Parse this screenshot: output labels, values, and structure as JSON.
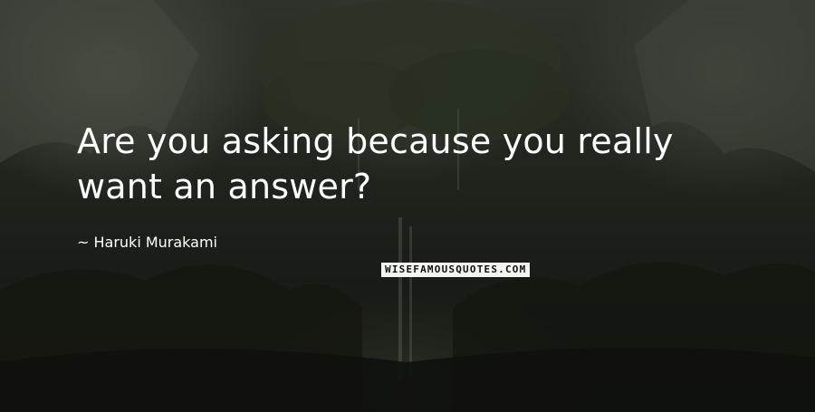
{
  "quote": {
    "text_line1": "Are you asking because you really",
    "text_line2": "want an answer?",
    "author_line": "~ Haruki Murakami"
  },
  "watermark": {
    "text": "WISEFAMOUSQUOTES.COM"
  },
  "background": {
    "description_colors": [
      "#161813",
      "#2f322b",
      "#4a4d44"
    ]
  }
}
